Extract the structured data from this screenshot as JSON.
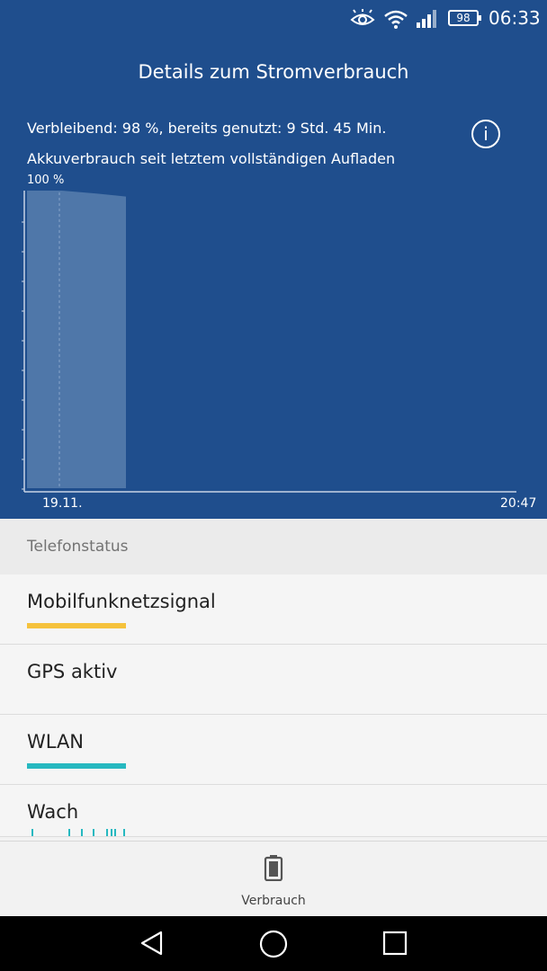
{
  "status_bar": {
    "battery_level": "98",
    "time": "06:33",
    "icons": [
      "eye-icon",
      "wifi-icon",
      "cell-signal-icon",
      "battery-icon"
    ]
  },
  "header": {
    "title": "Details zum Stromverbrauch",
    "remaining": "Verbleibend: 98 %, bereits genutzt: 9 Std. 45 Min.",
    "usage_since": "Akkuverbrauch seit letztem vollständigen Aufladen",
    "info_icon": "info-icon"
  },
  "chart_data": {
    "type": "area",
    "ylabel_top": "100 %",
    "x_labels": [
      "19.11.",
      "20:47"
    ],
    "ylim": [
      0,
      100
    ],
    "x": [
      0,
      0.35,
      0.7,
      1.0
    ],
    "values": [
      100,
      100,
      99,
      98
    ],
    "fill_color": "#4f77a9",
    "grid": false
  },
  "section": {
    "title": "Telefonstatus"
  },
  "list": [
    {
      "label": "Mobilfunknetzsignal",
      "bar_color": "#f5c23c",
      "bar_fill": 1
    },
    {
      "label": "GPS aktiv"
    },
    {
      "label": "WLAN",
      "bar_color": "#26b8c0",
      "bar_fill": 1
    },
    {
      "label": "Wach"
    }
  ],
  "bottom_nav": {
    "tab_label": "Verbrauch",
    "tab_icon": "battery-icon"
  },
  "system_nav": [
    "back-icon",
    "home-icon",
    "recents-icon"
  ]
}
